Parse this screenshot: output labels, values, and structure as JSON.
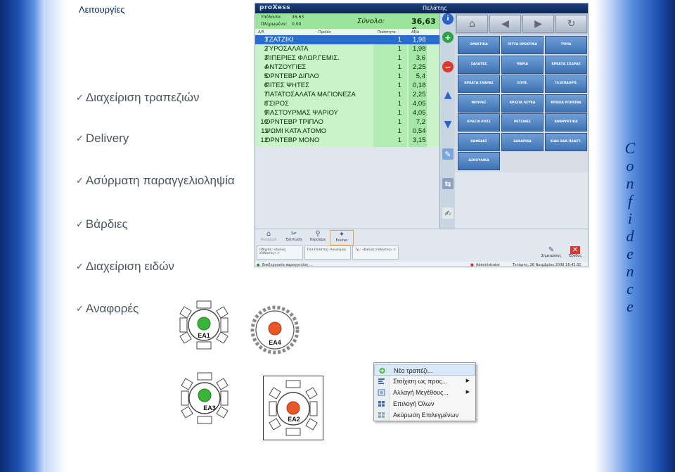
{
  "slide": {
    "title": "Λειτουργίες",
    "bullets": [
      "Διαχείριση τραπεζιών",
      "Delivery",
      "Ασύρματη παραγγελιοληψία",
      "Βάρδιες",
      "Διαχείριση ειδών",
      "Αναφορές"
    ],
    "confidence_letters": [
      "C",
      "o",
      "n",
      "f",
      "i",
      "d",
      "e",
      "n",
      "c",
      "e"
    ]
  },
  "pos": {
    "logo": "proXess",
    "window_title": "Πελάτης",
    "summary": {
      "remaining_label": "Υπόλοιπο:",
      "remaining_value": "36,63",
      "paid_label": "Πληρωμένα:",
      "paid_value": "0,00",
      "total_label": "Σύνολο:",
      "total_value": "36,63 €",
      "close": "✕"
    },
    "columns": [
      "Α/Α",
      "Προϊόν",
      "Ποσότητα",
      "Αξία"
    ],
    "rows": [
      {
        "n": "1",
        "name": "ΤΖΑΤΖΙΚΙ",
        "qty": "1",
        "val": "1,98"
      },
      {
        "n": "2",
        "name": "ΤΥΡΟΣΑΛΑΤΑ",
        "qty": "1",
        "val": "1,98"
      },
      {
        "n": "3",
        "name": "ΠΙΠΕΡΙΕΣ ΦΛΩΡ.ΓΕΜΙΣ.",
        "qty": "1",
        "val": "3,6"
      },
      {
        "n": "4",
        "name": "ΑΝΤΖΟΥΓΙΕΣ",
        "qty": "1",
        "val": "2,25"
      },
      {
        "n": "5",
        "name": "ΟΡΝΤΕΒΡ ΔΙΠΛΟ",
        "qty": "1",
        "val": "5,4"
      },
      {
        "n": "6",
        "name": "ΠΙΤΕΣ ΨΗΤΕΣ",
        "qty": "1",
        "val": "0,18"
      },
      {
        "n": "7",
        "name": "ΠΑΤΑΤΟΣΑΛΑΤΑ ΜΑΓΙΟΝΕΖΑ",
        "qty": "1",
        "val": "2,25"
      },
      {
        "n": "8",
        "name": "ΤΣΙΡΟΣ",
        "qty": "1",
        "val": "4,05"
      },
      {
        "n": "9",
        "name": "ΠΑΣΤΟΥΡΜΑΣ ΨΑΡΙΟΥ",
        "qty": "1",
        "val": "4,05"
      },
      {
        "n": "10",
        "name": "ΟΡΝΤΕΒΡ ΤΡΙΠΛΟ",
        "qty": "1",
        "val": "7,2"
      },
      {
        "n": "11",
        "name": "ΨΩΜΙ ΚΑΤΑ ΑΤΟΜΟ",
        "qty": "1",
        "val": "0,54"
      },
      {
        "n": "12",
        "name": "ΟΡΝΤΕΒΡ ΜΟΝΟ",
        "qty": "1",
        "val": "3,15"
      }
    ],
    "categories": [
      "ΟΡΕΚΤΙΚΑ",
      "ΠΙΤΤΑ ΟΡΕΚΤΙΚΑ",
      "ΤΥΡΙΑ",
      "ΣΑΛΑΤΕΣ",
      "ΨΑΡΙΑ",
      "ΚΡΕΑΤΑ ΣΧΑΡΑΣ",
      "ΚΡΕΑΤΑ ΣΧΑΡΑΣ",
      "ΣΟΥΒ.",
      "ΓΛ.ΕΠΙΔΟΡΠ.",
      "ΜΠΥΡΕΣ",
      "ΚΡΑΣΙΑ ΛΕΥΚΑ",
      "ΚΡΑΣΙΑ ΚΟΚΚΙΝΑ",
      "ΚΡΑΣΙΑ ΡΟΖΕ",
      "ΡΕΤΣΙΝΕΣ",
      "ΑΝΑΨΥΚΤΙΚΑ",
      "ΚΑΦΕΔΕΣ",
      "ΖΑΧΑΡΙΚΑ",
      "ΕΙΔΗ ΖΑΧ.ΠΛΑΣΤ.",
      "ΑΣΚΟΥΛΙΚΑ"
    ],
    "bottom_buttons": [
      "Αναφορά",
      "Έκπτωση",
      "Κέρασμα",
      "Εικόνα"
    ],
    "info_boxes": [
      "Οδηγός: «Καλώς ελθόντες» >",
      "Πελ.Πελάτης: Ανωνύμος",
      "Τρ.: «Καλώς ελθόντες» >"
    ],
    "print_label": "Σημειώσεις",
    "exit_label": "Έξοδος",
    "status_left": "Επεξεργασία παραγγελίας ...",
    "status_user": "Administrator",
    "status_date": "Τετάρτη, 26 Νοεμβρίου 2008 16:42:31"
  },
  "tables": [
    {
      "label": "EA1",
      "status": "green",
      "color": "#3ab53a"
    },
    {
      "label": "EA4",
      "status": "red",
      "color": "#e8572a"
    },
    {
      "label": "EA3",
      "status": "green",
      "color": "#3ab53a"
    },
    {
      "label": "EA2",
      "status": "red",
      "color": "#e8572a"
    }
  ],
  "context_menu": {
    "items": [
      {
        "label": "Νέο τραπέζι...",
        "icon": "new-table-icon",
        "submenu": false
      },
      {
        "label": "Στοίχιση ως προς...",
        "icon": "align-icon",
        "submenu": true
      },
      {
        "label": "Αλλαγή Μεγέθους...",
        "icon": "resize-icon",
        "submenu": true
      },
      {
        "label": "Επιλογή Όλων",
        "icon": "select-all-icon",
        "submenu": false
      },
      {
        "label": "Ακύρωση Επιλεγμένων",
        "icon": "cancel-selection-icon",
        "submenu": false
      }
    ]
  }
}
